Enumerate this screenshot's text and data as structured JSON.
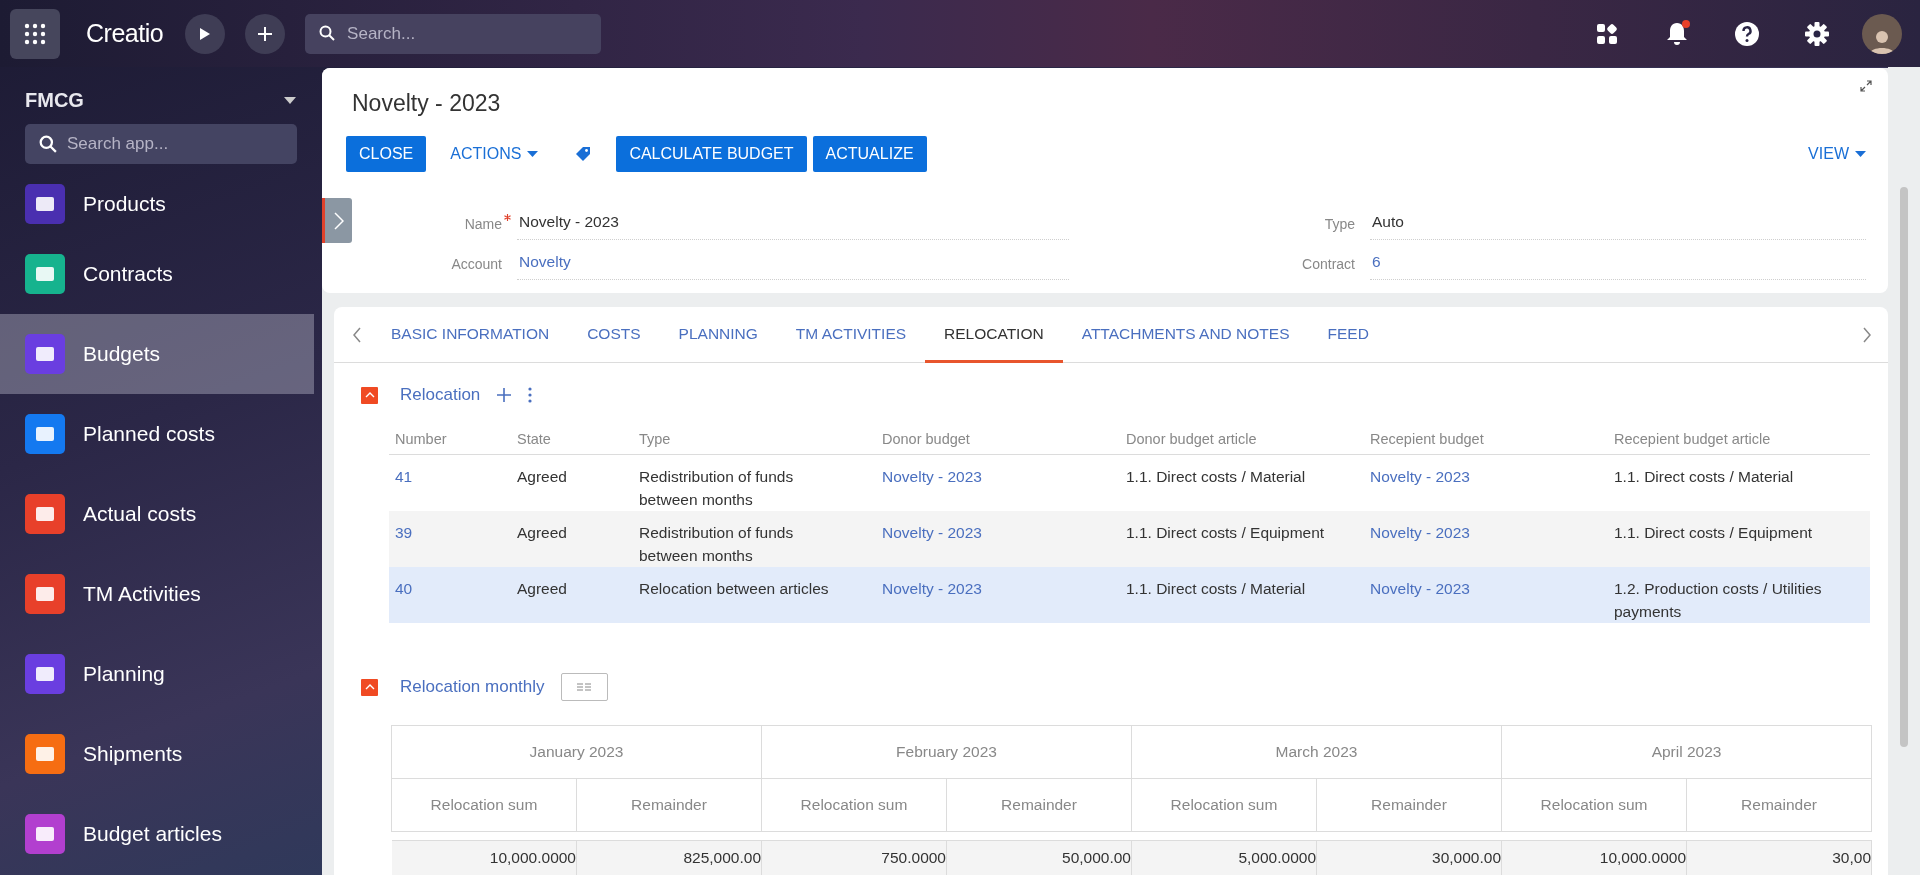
{
  "topbar": {
    "logo": "Creatio",
    "search": {
      "placeholder": "Search..."
    },
    "has_notification": true
  },
  "sidebar": {
    "workspace": "FMCG",
    "search": {
      "placeholder": "Search app..."
    },
    "items": [
      {
        "label": "Products",
        "color": "#4a2fb0",
        "selected": false
      },
      {
        "label": "Contracts",
        "color": "#16b38e",
        "selected": false
      },
      {
        "label": "Budgets",
        "color": "#6a3ee0",
        "selected": true
      },
      {
        "label": "Planned costs",
        "color": "#1479f0",
        "selected": false
      },
      {
        "label": "Actual costs",
        "color": "#e8402a",
        "selected": false
      },
      {
        "label": "TM Activities",
        "color": "#e8402a",
        "selected": false
      },
      {
        "label": "Planning",
        "color": "#6a3ee0",
        "selected": false
      },
      {
        "label": "Shipments",
        "color": "#f66d12",
        "selected": false
      },
      {
        "label": "Budget articles",
        "color": "#b23fcf",
        "selected": false
      }
    ]
  },
  "record": {
    "title": "Novelty - 2023",
    "actions": [
      {
        "kind": "primary",
        "label": "CLOSE"
      },
      {
        "kind": "menu",
        "label": "ACTIONS"
      },
      {
        "kind": "tag"
      },
      {
        "kind": "primary",
        "label": "CALCULATE BUDGET"
      },
      {
        "kind": "primary",
        "label": "ACTUALIZE"
      }
    ],
    "view": "VIEW",
    "fields": [
      {
        "label": "Name",
        "required": true,
        "value": "Novelty - 2023",
        "kind": "text"
      },
      {
        "label": "Type",
        "required": false,
        "value": "Auto",
        "kind": "text"
      },
      {
        "label": "Account",
        "required": false,
        "value": "Novelty",
        "kind": "link"
      },
      {
        "label": "Contract",
        "required": false,
        "value": "6",
        "kind": "link"
      }
    ]
  },
  "tabs": [
    {
      "label": "BASIC INFORMATION",
      "selected": false
    },
    {
      "label": "COSTS",
      "selected": false
    },
    {
      "label": "PLANNING",
      "selected": false
    },
    {
      "label": "TM ACTIVITIES",
      "selected": false
    },
    {
      "label": "RELOCATION",
      "selected": true
    },
    {
      "label": "ATTACHMENTS AND NOTES",
      "selected": false
    },
    {
      "label": "FEED",
      "selected": false
    }
  ],
  "relocation": {
    "title": "Relocation",
    "expanded": true,
    "columns": [
      "Number",
      "State",
      "Type",
      "Donor budget",
      "Donor budget article",
      "Recepient budget",
      "Recepient budget article"
    ],
    "rows": [
      {
        "selected": false,
        "cells": [
          "41",
          "Agreed",
          "Redistribution of funds between months",
          "Novelty - 2023",
          "1.1. Direct costs / Material",
          "Novelty - 2023",
          "1.1. Direct costs / Material"
        ]
      },
      {
        "selected": false,
        "cells": [
          "39",
          "Agreed",
          "Redistribution of funds between months",
          "Novelty - 2023",
          "1.1. Direct costs / Equipment",
          "Novelty - 2023",
          "1.1. Direct costs / Equipment"
        ]
      },
      {
        "selected": true,
        "cells": [
          "40",
          "Agreed",
          "Relocation between articles",
          "Novelty - 2023",
          "1.1. Direct costs / Material",
          "Novelty - 2023",
          "1.2. Production costs / Utilities payments"
        ]
      }
    ]
  },
  "relocation_monthly": {
    "title": "Relocation monthly",
    "expanded": true,
    "months": [
      {
        "name": "January 2023",
        "columns": [
          "Relocation sum",
          "Remainder"
        ]
      },
      {
        "name": "February 2023",
        "columns": [
          "Relocation sum",
          "Remainder"
        ]
      },
      {
        "name": "March 2023",
        "columns": [
          "Relocation sum",
          "Remainder"
        ]
      },
      {
        "name": "April 2023",
        "columns": [
          "Relocation sum",
          "Remainder"
        ]
      }
    ],
    "rows": [
      [
        "10,000.0000",
        "825,000.00",
        "750.0000",
        "50,000.00",
        "5,000.0000",
        "30,000.00",
        "10,000.0000",
        "30,00"
      ]
    ]
  }
}
